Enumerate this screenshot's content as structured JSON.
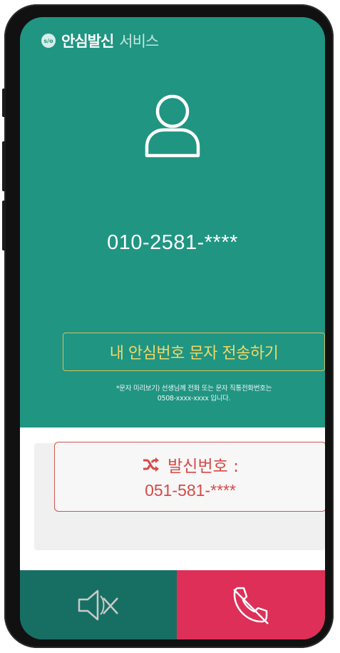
{
  "header": {
    "logo_text": "s/o",
    "brand_bold": "안심발신",
    "brand_light": "서비스"
  },
  "call": {
    "number": "010-2581-****"
  },
  "sms_button": {
    "label": "내 안심번호 문자 전송하기"
  },
  "notice": {
    "line1": "*문자 미리보기) 선생님께 전화 또는 문자 직통전화번호는",
    "line2": "0508-xxxx-xxxx 입니다."
  },
  "caller_id": {
    "label": "발신번호 :",
    "number": "051-581-****"
  },
  "colors": {
    "screen_green": "#1f9582",
    "dark_green": "#176f63",
    "end_call_red": "#dd2f58",
    "accent_yellow": "#f2d868",
    "caller_red": "#d64a47"
  },
  "icons": {
    "avatar": "user-outline-icon",
    "shuffle": "shuffle-icon",
    "mute": "speaker-mute-icon",
    "end_call": "phone-hangup-icon"
  }
}
